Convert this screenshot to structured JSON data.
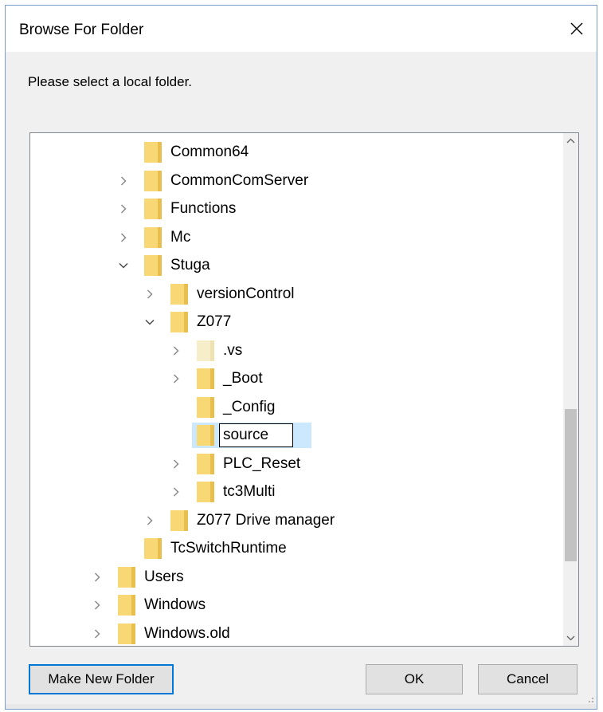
{
  "window": {
    "title": "Browse For Folder",
    "prompt": "Please select a local folder."
  },
  "tree": {
    "nodes": [
      {
        "label": "Common64",
        "level": 3,
        "expander": "none"
      },
      {
        "label": "CommonComServer",
        "level": 3,
        "expander": "collapsed"
      },
      {
        "label": "Functions",
        "level": 3,
        "expander": "collapsed"
      },
      {
        "label": "Mc",
        "level": 3,
        "expander": "collapsed"
      },
      {
        "label": "Stuga",
        "level": 3,
        "expander": "expanded"
      },
      {
        "label": "versionControl",
        "level": 4,
        "expander": "collapsed"
      },
      {
        "label": "Z077",
        "level": 4,
        "expander": "expanded"
      },
      {
        "label": ".vs",
        "level": 5,
        "expander": "collapsed",
        "hidden": true
      },
      {
        "label": "_Boot",
        "level": 5,
        "expander": "collapsed"
      },
      {
        "label": "_Config",
        "level": 5,
        "expander": "none"
      },
      {
        "label": "source",
        "level": 5,
        "expander": "none",
        "selected": true,
        "editing": true
      },
      {
        "label": "PLC_Reset",
        "level": 5,
        "expander": "collapsed"
      },
      {
        "label": "tc3Multi",
        "level": 5,
        "expander": "collapsed"
      },
      {
        "label": "Z077 Drive manager",
        "level": 4,
        "expander": "collapsed"
      },
      {
        "label": "TcSwitchRuntime",
        "level": 3,
        "expander": "none"
      },
      {
        "label": "Users",
        "level": 2,
        "expander": "collapsed"
      },
      {
        "label": "Windows",
        "level": 2,
        "expander": "collapsed"
      },
      {
        "label": "Windows.old",
        "level": 2,
        "expander": "collapsed"
      }
    ]
  },
  "scroll": {
    "position_fraction": 0.79
  },
  "buttons": {
    "make_new_folder": "Make New Folder",
    "ok": "OK",
    "cancel": "Cancel"
  },
  "icons": {
    "close": "close-icon",
    "folder": "folder-icon",
    "chevron_right": "chevron-right-icon",
    "chevron_down": "chevron-down-icon",
    "scroll_up": "chevron-up-icon",
    "scroll_down": "chevron-down-icon",
    "grip": "resize-grip-icon"
  },
  "colors": {
    "folder": "#f8d775",
    "folder_hidden": "#f6edc9",
    "selection": "#cce8ff",
    "default_button_border": "#0078d7",
    "chevron": "#8a8a8a"
  }
}
